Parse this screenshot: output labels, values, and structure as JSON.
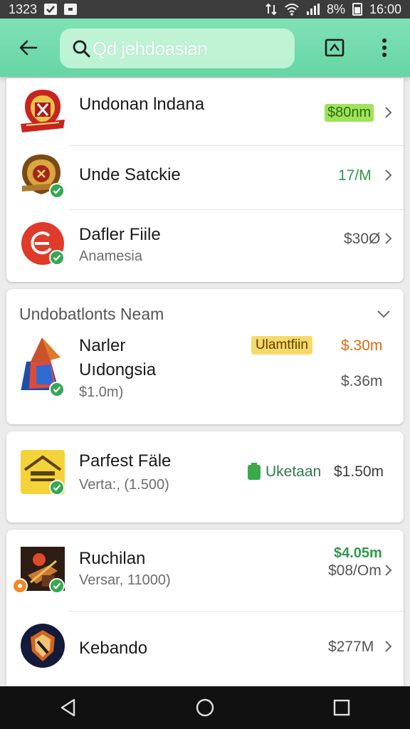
{
  "status_bar": {
    "time_left": "1323",
    "battery_percent": "8%",
    "clock": "16:00"
  },
  "toolbar": {
    "search_text": "Qd jehdoasian",
    "icons": [
      "back-arrow-icon",
      "search-icon",
      "image-search-icon",
      "more-vert-icon"
    ]
  },
  "card1": {
    "items": [
      {
        "title": "Undonan lndana",
        "subtitle": "",
        "price": "$80nm",
        "price_style": "green-badge",
        "icon": "red-crest-icon"
      },
      {
        "title": "Unde Satckie",
        "subtitle": "",
        "price": "17/M",
        "price_style": "green-text",
        "icon": "gold-crest-icon"
      },
      {
        "title": "Dafler Fiile",
        "subtitle": "Anamesia",
        "price": "$30Ø",
        "price_style": "plain",
        "icon": "red-circle-logo-icon"
      }
    ]
  },
  "card2": {
    "section_title": "Undobatlonts Neam",
    "item": {
      "title_line1": "Narler",
      "title_line2": "Uıdongsia",
      "subtitle": "$1.0m)",
      "badge": "Ulamtfiin",
      "price_top": "$.30m",
      "price_bottom": "$.36m",
      "icon": "geometric-logo-icon"
    }
  },
  "card3": {
    "item": {
      "title": "Parfest Fäle",
      "subtitle": "Verta:, (1.500)",
      "status_label": "Uketaan",
      "price": "$1.50m",
      "icon": "yellow-house-icon"
    }
  },
  "card4": {
    "items": [
      {
        "title": "Ruchilan",
        "subtitle": "Versar, 11000)",
        "price_top": "$4.05m",
        "price_bottom": "$08/Om",
        "icon": "game-character-icon"
      },
      {
        "title": "Kebando",
        "subtitle": "",
        "price": "$277M",
        "icon": "shield-emblem-icon"
      }
    ]
  },
  "colors": {
    "toolbar": "#6fdaa9",
    "green_badge": "#9fe35a",
    "yellow_badge": "#f7d96b",
    "orange_price": "#e06a10",
    "green_price": "#2f9a4c"
  }
}
